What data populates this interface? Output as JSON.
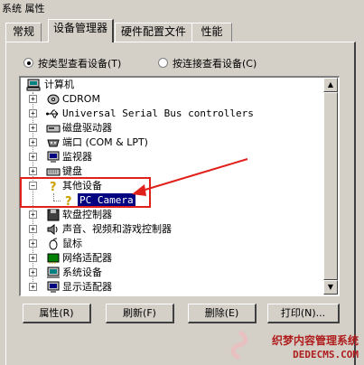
{
  "window": {
    "title": "系统 属性"
  },
  "tabs": [
    {
      "label": "常规"
    },
    {
      "label": "设备管理器"
    },
    {
      "label": "硬件配置文件"
    },
    {
      "label": "性能"
    }
  ],
  "view_options": [
    {
      "label": "按类型查看设备(T)",
      "checked": true
    },
    {
      "label": "按连接查看设备(C)",
      "checked": false
    }
  ],
  "tree": {
    "root": "计算机",
    "items": [
      {
        "label": "CDROM",
        "icon": "cdrom-icon"
      },
      {
        "label": "Universal Serial Bus controllers",
        "icon": "usb-icon"
      },
      {
        "label": "磁盘驱动器",
        "icon": "disk-drive-icon"
      },
      {
        "label": "端口 (COM & LPT)",
        "icon": "port-icon"
      },
      {
        "label": "监视器",
        "icon": "monitor-icon"
      },
      {
        "label": "键盘",
        "icon": "keyboard-icon"
      },
      {
        "label": "其他设备",
        "icon": "unknown-device-icon",
        "expanded": true
      },
      {
        "label": "PC Camera",
        "icon": "unknown-device-icon",
        "child": true,
        "selected": true
      },
      {
        "label": "软盘控制器",
        "icon": "floppy-controller-icon"
      },
      {
        "label": "声音、视频和游戏控制器",
        "icon": "sound-icon"
      },
      {
        "label": "鼠标",
        "icon": "mouse-icon"
      },
      {
        "label": "网络适配器",
        "icon": "network-icon"
      },
      {
        "label": "系统设备",
        "icon": "system-device-icon"
      },
      {
        "label": "显示适配器",
        "icon": "display-adapter-icon"
      }
    ]
  },
  "buttons": {
    "properties": "属性(R)",
    "refresh": "刷新(F)",
    "remove": "删除(E)",
    "print": "打印(N)..."
  },
  "watermark": {
    "line1": "织梦内容管理系统",
    "line2": "DEDECMS.COM"
  },
  "colors": {
    "selection": "#000080",
    "annotation": "#e0201a",
    "face": "#d4d0c8"
  }
}
